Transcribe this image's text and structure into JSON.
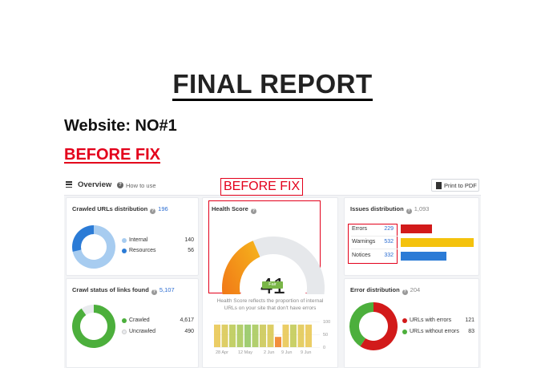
{
  "page": {
    "title": "FINAL REPORT",
    "website_line": "Website: NO#1",
    "before_fix_heading": "BEFORE FIX"
  },
  "screenshot": {
    "topbar": {
      "overview": "Overview",
      "how_to_use": "How to use",
      "before_fix_label": "BEFORE FIX",
      "print_button": "Print to PDF",
      "icons": [
        "menu-icon",
        "help-icon",
        "pdf-icon"
      ]
    },
    "crawled_urls": {
      "title": "Crawled URLs distribution",
      "count": "196",
      "legend": [
        {
          "label": "Internal",
          "value": 140,
          "color": "#a7ccf0"
        },
        {
          "label": "Resources",
          "value": 56,
          "color": "#2b7bd6"
        }
      ]
    },
    "crawl_status": {
      "title": "Crawl status of links found",
      "count": "5,107",
      "legend": [
        {
          "label": "Crawled",
          "value": "4,617",
          "num": 4617,
          "color": "#4caf3c"
        },
        {
          "label": "Uncrawled",
          "value": "490",
          "num": 490,
          "color": "#e9ebee"
        }
      ]
    },
    "health_score": {
      "title": "Health Score",
      "value": "41",
      "status": "Fair",
      "score_fraction": 0.41,
      "description": "Health Score reflects the proportion of internal URLs on your site that don't have errors",
      "axis_y": [
        "100",
        "50",
        "0"
      ],
      "axis_x": [
        "28 Apr",
        "12 May",
        "2 Jun",
        "9 Jun",
        "9 Jun"
      ],
      "history": [
        {
          "level": 0.88,
          "color": "#e8c44a"
        },
        {
          "level": 0.88,
          "color": "#d8c64a"
        },
        {
          "level": 0.88,
          "color": "#b8c84e"
        },
        {
          "level": 0.88,
          "color": "#a7c753"
        },
        {
          "level": 0.88,
          "color": "#8fc45a"
        },
        {
          "level": 0.88,
          "color": "#a4c755"
        },
        {
          "level": 0.88,
          "color": "#c9c64d"
        },
        {
          "level": 0.88,
          "color": "#d7c54a"
        },
        {
          "level": 0.4,
          "color": "#f07a1a"
        },
        {
          "level": 0.88,
          "color": "#e8c44a"
        },
        {
          "level": 0.88,
          "color": "#c0c84e"
        },
        {
          "level": 0.88,
          "color": "#e0c64b"
        },
        {
          "level": 0.88,
          "color": "#e8c44a"
        }
      ]
    },
    "issues": {
      "title": "Issues distribution",
      "count": "1,093",
      "rows": [
        {
          "label": "Errors",
          "value": "229",
          "num": 229,
          "color": "#d21a1a"
        },
        {
          "label": "Warnings",
          "value": "532",
          "num": 532,
          "color": "#f4c20d"
        },
        {
          "label": "Notices",
          "value": "332",
          "num": 332,
          "color": "#2b7bd6"
        }
      ]
    },
    "error_distribution": {
      "title": "Error distribution",
      "count": "204",
      "legend": [
        {
          "label": "URLs with errors",
          "value": 121,
          "color": "#d21a1a"
        },
        {
          "label": "URLs without errors",
          "value": 83,
          "color": "#4caf3c"
        }
      ]
    }
  }
}
